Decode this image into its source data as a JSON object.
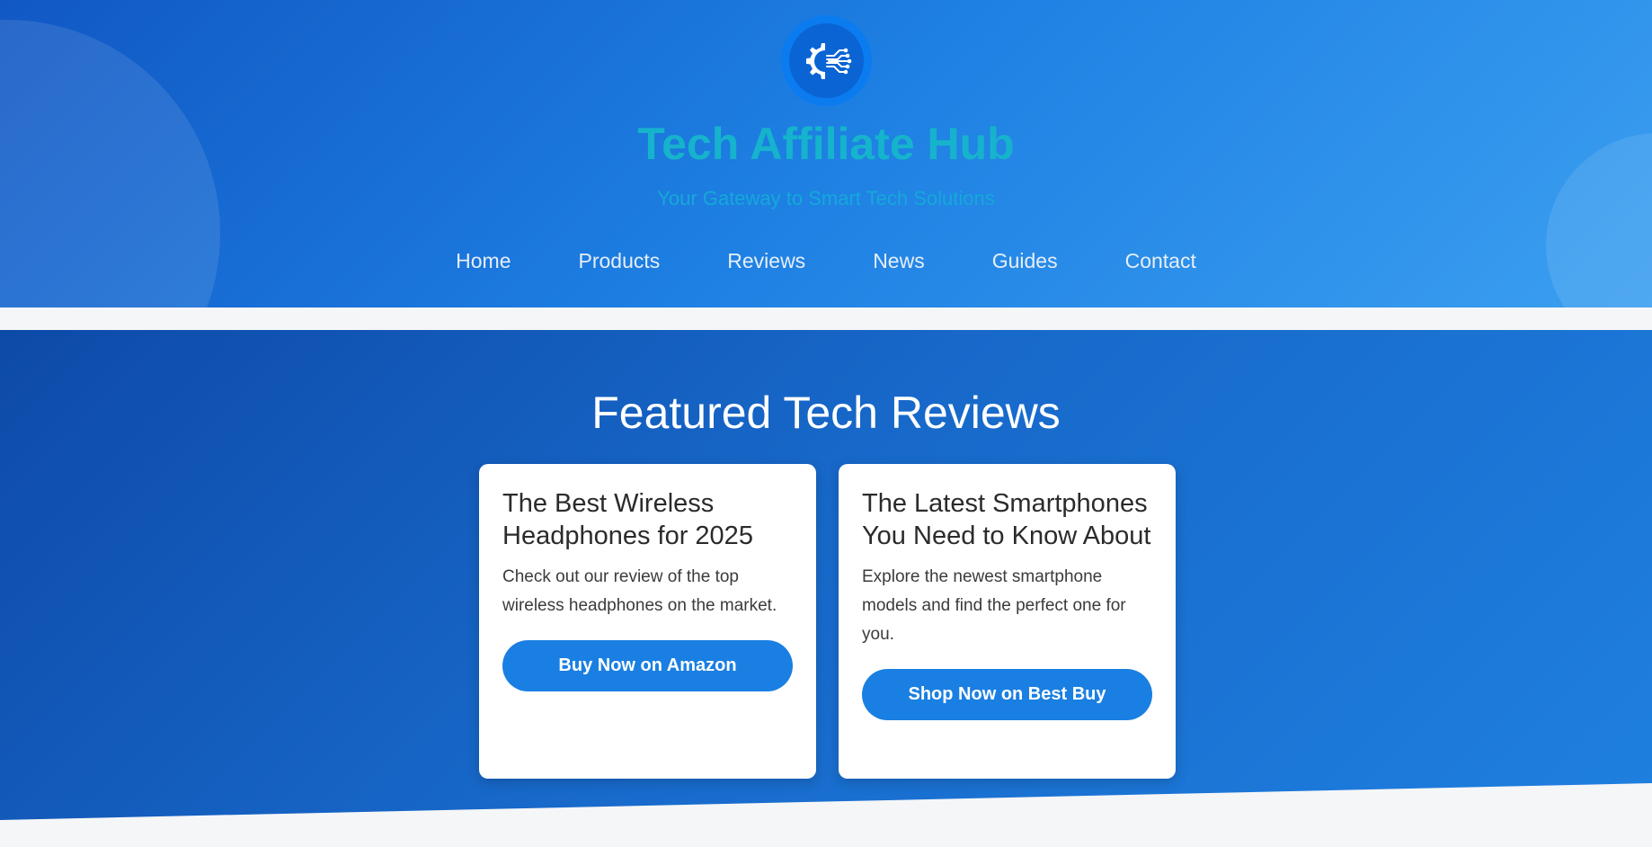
{
  "header": {
    "logo_icon": "gear-circuit-icon",
    "title": "Tech Affiliate Hub",
    "tagline": "Your Gateway to Smart Tech Solutions",
    "colors": {
      "gradient_start": "#1158c4",
      "gradient_end": "#3b9ff0",
      "title": "#16b3cc",
      "tagline": "#14a9d8"
    }
  },
  "nav": {
    "items": [
      {
        "label": "Home"
      },
      {
        "label": "Products"
      },
      {
        "label": "Reviews"
      },
      {
        "label": "News"
      },
      {
        "label": "Guides"
      },
      {
        "label": "Contact"
      }
    ]
  },
  "featured": {
    "title": "Featured Tech Reviews",
    "cards": [
      {
        "title": "The Best Wireless Headphones for 2025",
        "text": "Check out our review of the top wireless headphones on the market.",
        "button": "Buy Now on Amazon"
      },
      {
        "title": "The Latest Smartphones You Need to Know About",
        "text": "Explore the newest smartphone models and find the perfect one for you.",
        "button": "Shop Now on Best Buy"
      }
    ],
    "colors": {
      "button": "#1a7fe2",
      "section_start": "#0e4aa8",
      "section_end": "#1f80e0"
    }
  }
}
